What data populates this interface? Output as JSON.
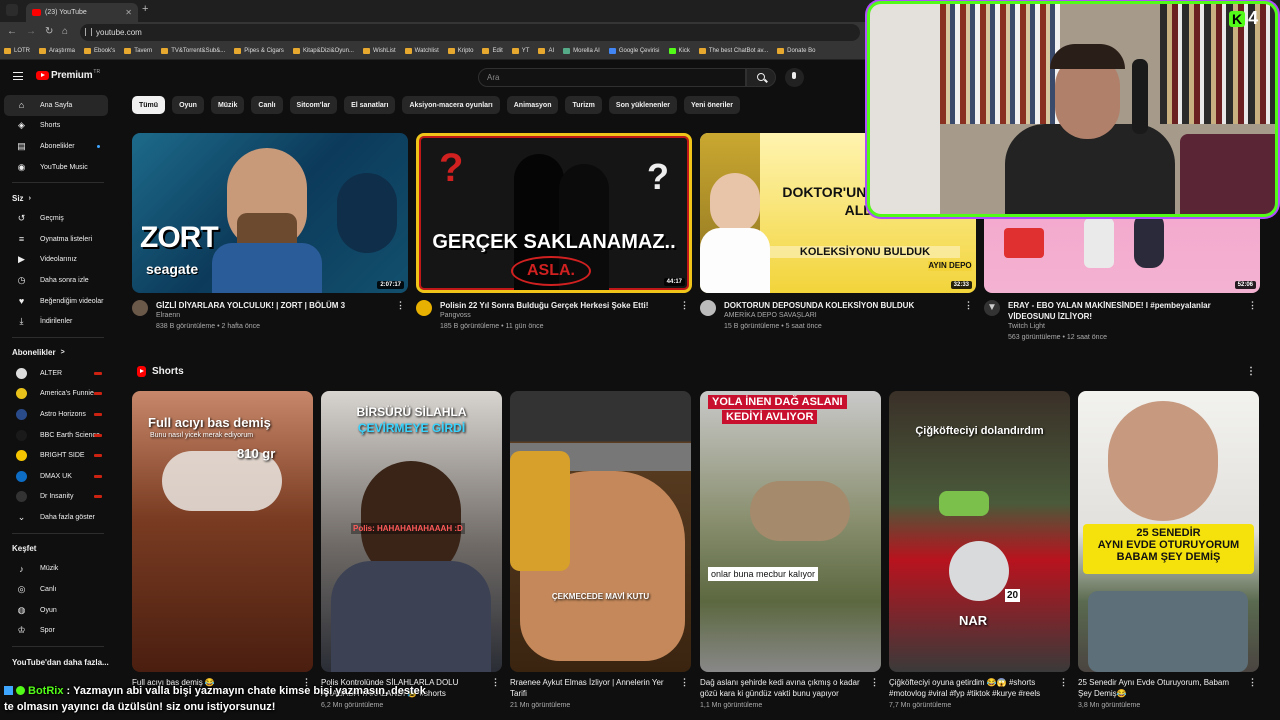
{
  "browser": {
    "tab_title": "(23) YouTube",
    "tab_close": "✕",
    "new_tab": "+",
    "url": "youtube.com",
    "bookmarks": [
      "LOTR",
      "Araştırma",
      "Ebook's",
      "Tavern",
      "TV&Torrent&Sub&...",
      "Pipes & Cigars",
      "Kitap&Dizi&Oyun...",
      "WishList",
      "Watchlist",
      "Kripto",
      "Edit",
      "YT",
      "AI",
      "Morella AI",
      "Google Çevirisi",
      "Kick",
      "The best ChatBot av...",
      "Donate Bo"
    ]
  },
  "youtube": {
    "logo_text": "Premium",
    "logo_mark": "TR",
    "search_placeholder": "Ara",
    "chips": [
      "Tümü",
      "Oyun",
      "Müzik",
      "Canlı",
      "Sitcom'lar",
      "El sanatları",
      "Aksiyon-macera oyunları",
      "Animasyon",
      "Turizm",
      "Son yüklenenler",
      "Yeni öneriler"
    ],
    "sidebar": {
      "main": [
        {
          "label": "Ana Sayfa",
          "icon": "home-icon",
          "glyph": "⌂"
        },
        {
          "label": "Shorts",
          "icon": "shorts-icon",
          "glyph": "◈"
        },
        {
          "label": "Abonelikler",
          "icon": "subscriptions-icon",
          "glyph": "▤"
        },
        {
          "label": "YouTube Music",
          "icon": "music-icon",
          "glyph": "◉"
        }
      ],
      "you_header": "Siz",
      "you": [
        {
          "label": "Geçmiş",
          "icon": "history-icon",
          "glyph": "↺"
        },
        {
          "label": "Oynatma listeleri",
          "icon": "playlists-icon",
          "glyph": "≡"
        },
        {
          "label": "Videolarınız",
          "icon": "your-videos-icon",
          "glyph": "▶"
        },
        {
          "label": "Daha sonra izle",
          "icon": "watch-later-icon",
          "glyph": "◷"
        },
        {
          "label": "Beğendiğim videolar",
          "icon": "liked-icon",
          "glyph": "♥"
        },
        {
          "label": "İndirilenler",
          "icon": "downloads-icon",
          "glyph": "⤓"
        }
      ],
      "subs_header": "Abonelikler",
      "subs_arrow": ">",
      "subs": [
        {
          "label": "ALTER",
          "color": "#dddddd"
        },
        {
          "label": "America's Funnie...",
          "color": "#e8c21a"
        },
        {
          "label": "Astro Horizons",
          "color": "#2a4b8a"
        },
        {
          "label": "BBC Earth Science",
          "color": "#1a1a1a"
        },
        {
          "label": "BRIGHT SIDE",
          "color": "#f5c400"
        },
        {
          "label": "DMAX UK",
          "color": "#0d6cc4"
        },
        {
          "label": "Dr Insanity",
          "color": "#333333"
        }
      ],
      "show_more": "Daha fazla göster",
      "explore_header": "Keşfet",
      "explore": [
        {
          "label": "Müzik",
          "icon": "music-note-icon",
          "glyph": "♪"
        },
        {
          "label": "Canlı",
          "icon": "live-icon",
          "glyph": "◎"
        },
        {
          "label": "Oyun",
          "icon": "gaming-icon",
          "glyph": "◍"
        },
        {
          "label": "Spor",
          "icon": "trophy-icon",
          "glyph": "♔"
        }
      ],
      "more_from": "YouTube'dan daha fazla..."
    },
    "videos": [
      {
        "title": "GİZLİ DİYARLARA YOLCULUK! | ZORT | BÖLÜM 3",
        "channel": "Elraenn",
        "stats": "838 B görüntüleme • 2 hafta önce",
        "duration": "2:07:17",
        "overlay_main": "ZORT",
        "overlay_sub": "seagate"
      },
      {
        "title": "Polisin 22 Yıl Sonra Bulduğu Gerçek Herkesi Şoke Etti!",
        "channel": "Pangvoss",
        "stats": "185 B görüntüleme • 11 gün önce",
        "duration": "44:17",
        "overlay_main": "GERÇEK SAKLANAMAZ..",
        "overlay_sub": "ASLA."
      },
      {
        "title": "DOKTORUN DEPOSUNDA KOLEKSİYON BULDUK",
        "channel": "AMERİKA DEPO SAVAŞLARI",
        "stats": "15 B görüntüleme • 5 saat önce",
        "duration": "32:33",
        "overlay_main": "DOKTOR'UN DEPOSUNU ALDIK",
        "overlay_sub": "KOLEKSİYONU BULDUK",
        "overlay_extra": "AYIN DEPO"
      },
      {
        "title": "ERAY - EBO YALAN MAKİNESİNDE! I #pembeyalanlar VİDEOSUNU İZLİYOR!",
        "channel": "Twitch Light",
        "stats": "563 görüntüleme • 12 saat önce",
        "duration": "52:06"
      }
    ],
    "shorts_header": "Shorts",
    "shorts": [
      {
        "title": "Full acıyı bas demiş 😂",
        "views": "",
        "overlay": "Full acıyı bas demiş",
        "overlay2": "Bunu nasıl yicek merak ediyorum",
        "overlay3": "810 gr"
      },
      {
        "title": "Polis Kontrolünde SİLAHLARLA DOLU ARABADA YAKALANDI 😰 #shorts",
        "views": "6,2 Mn görüntüleme",
        "overlay": "BİRSÜRÜ SİLAHLA",
        "overlay2": "ÇEVİRMEYE GİRDİ",
        "overlay3": "Polis: HAHAHAHAHAAAH :D"
      },
      {
        "title": "Rraenee Aykut Elmas İzliyor | Annelerin Yer Tarifi",
        "views": "21 Mn görüntüleme",
        "overlay": "ÇEKMECEDE MAVİ KUTU"
      },
      {
        "title": "Dağ aslanı şehirde kedi avına çıkmış o kadar gözü kara ki gündüz vakti bunu yapıyor",
        "views": "1,1 Mn görüntüleme",
        "overlay": "YOLA İNEN DAĞ ASLANI",
        "overlay2": "KEDİYİ AVLIYOR",
        "overlay3": "onlar buna mecbur kalıyor"
      },
      {
        "title": "Çiğköfteciyi oyuna getirdim 😂😱 #shorts #motovlog #viral #fyp #tiktok #kurye #reels",
        "views": "7,7 Mn görüntüleme",
        "overlay": "Çiğköfteciyi dolandırdım",
        "overlay2": "NAR",
        "overlay3": "20"
      },
      {
        "title": "25 Senedir Aynı Evde Oturuyorum, Babam Şey Demiş😂",
        "views": "3,8 Mn görüntüleme",
        "overlay": "25 SENEDİR",
        "overlay2": "AYNI EVDE OTURUYORUM",
        "overlay3": "BABAM ŞEY DEMİŞ"
      }
    ],
    "more_glyph": "⋮"
  },
  "stream": {
    "logo": "4",
    "logo_k": "K",
    "chat_user": "BotRix",
    "chat_text": "Yazmayın abi valla bişi yazmayın chate kimse bişi yazmasın, destek te olmasın yayıncı da üzülsün! siz onu istiyorsunuz!"
  }
}
